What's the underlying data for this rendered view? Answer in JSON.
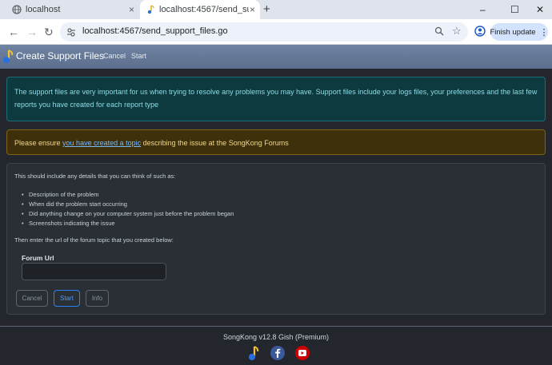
{
  "browser": {
    "tabs": [
      {
        "title": "localhost",
        "close": "×"
      },
      {
        "title": "localhost:4567/send_support_files.go",
        "close": "×"
      }
    ],
    "new_tab": "+",
    "window_controls": {
      "minimize": "–",
      "maximize": "☐",
      "close": "✕"
    },
    "nav": {
      "back": "←",
      "forward": "→",
      "reload": "↻"
    },
    "url": "localhost:4567/send_support_files.go",
    "star": "☆",
    "finish_update": "Finish update",
    "menu": "⋮"
  },
  "app": {
    "title": "Create Support Files",
    "nav_cancel": "Cancel",
    "nav_start": "Start"
  },
  "info_alert": "The support files are very important for us when trying to resolve any problems you may have. Support files include your logs files, your preferences and the last few reports you have created for each report type",
  "warn_alert": {
    "pre": "Please ensure ",
    "link": "you have created a topic",
    "post": " describing the issue at the SongKong Forums"
  },
  "card": {
    "intro": "This should include any details that you can think of such as:",
    "items": [
      "Description of the problem",
      "When did the problem start occurring",
      "Did anything change on your computer system just before the problem began",
      "Screenshots indicating the issue"
    ],
    "then": "Then enter the url of the forum topic that you created below:",
    "field_label": "Forum Url",
    "field_value": "",
    "btn_cancel": "Cancel",
    "btn_start": "Start",
    "btn_info": "Info"
  },
  "footer": {
    "version": "SongKong v12.8 Gish (Premium)",
    "icons": [
      "songkong-icon",
      "facebook-icon",
      "youtube-icon"
    ]
  },
  "colors": {
    "navbar": "#6a7e9d",
    "info_bg": "#0c3a3f",
    "warn_bg": "#3d300a",
    "start_blue": "#2f81f7",
    "facebook": "#3b5998",
    "youtube": "#cc0000"
  }
}
